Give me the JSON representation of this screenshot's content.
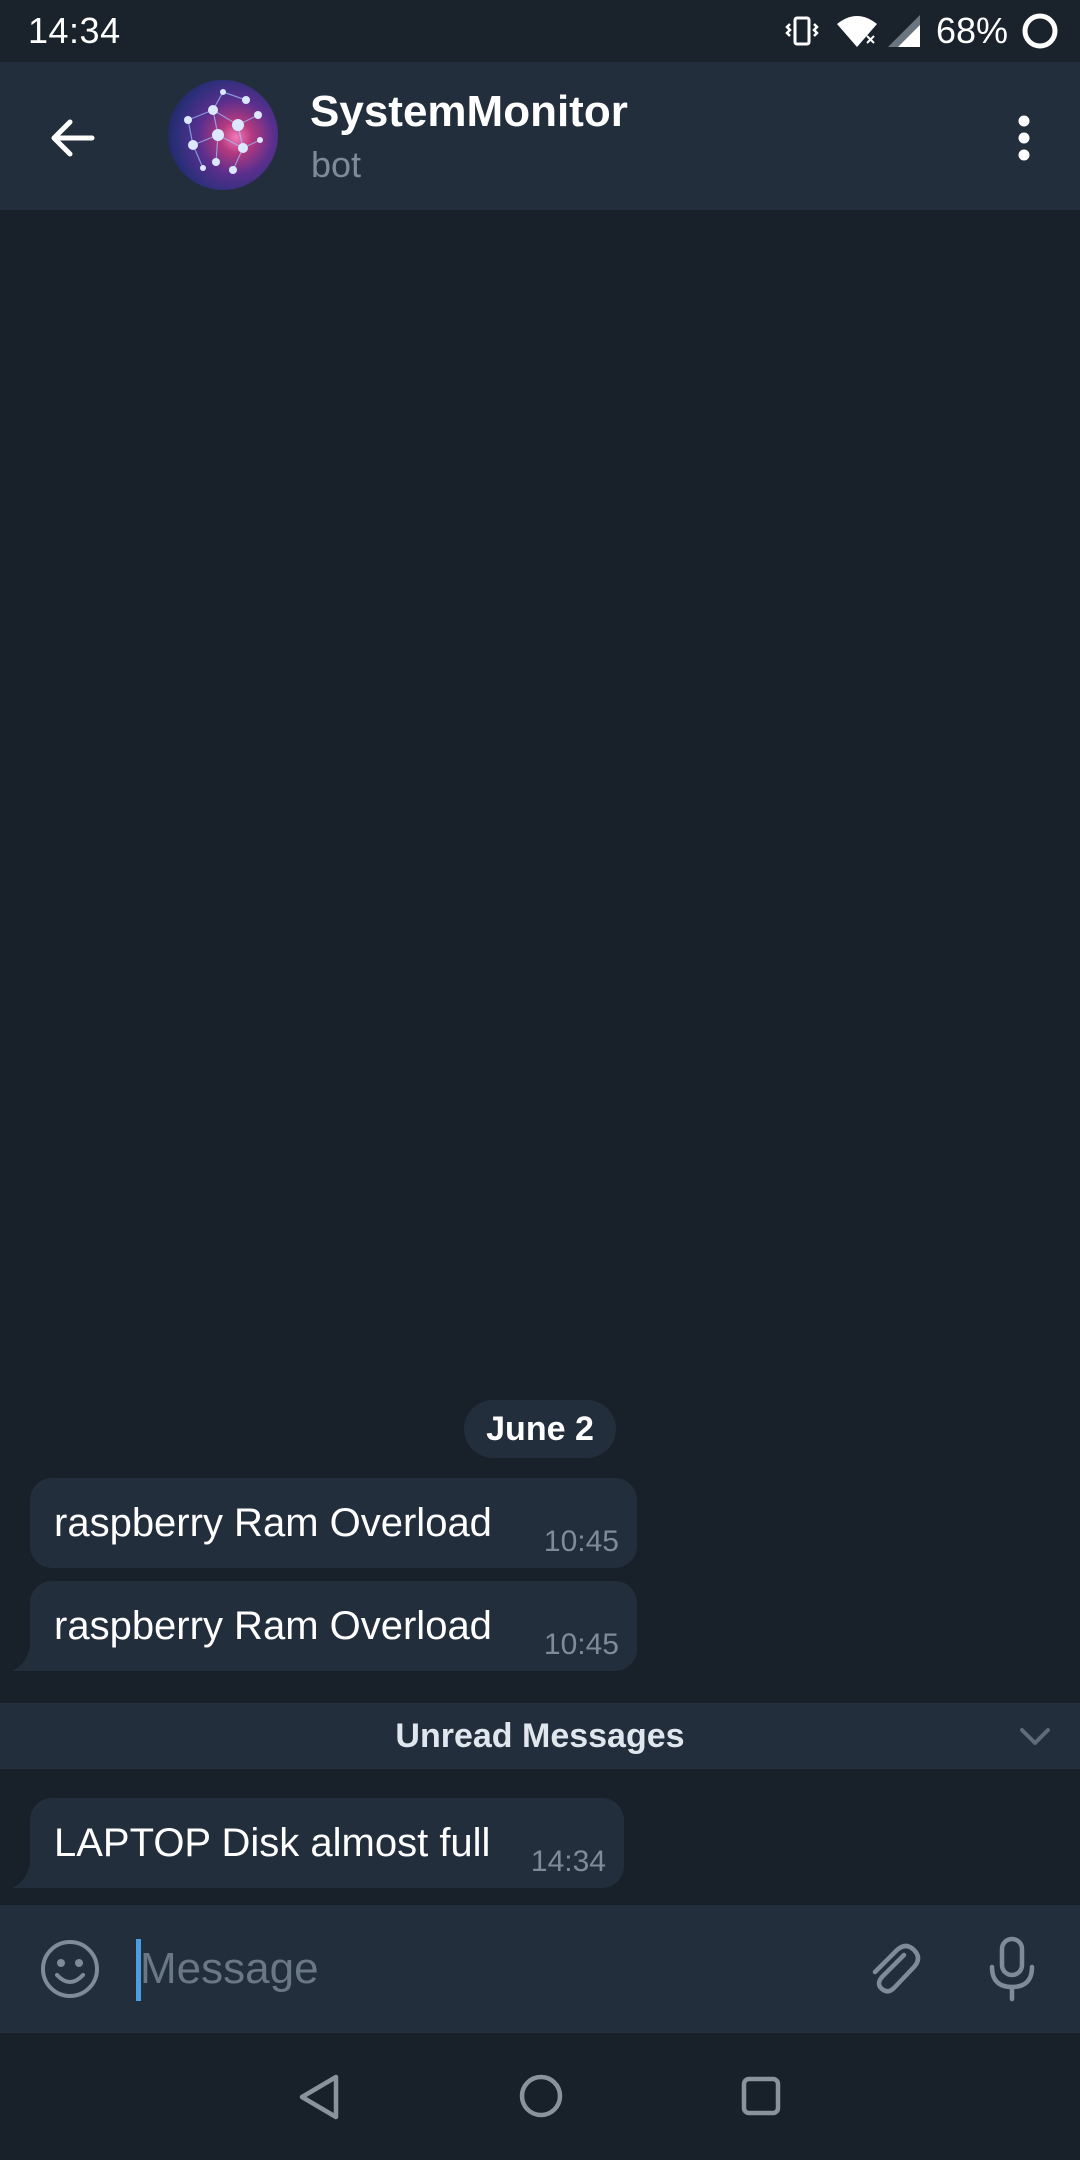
{
  "status_bar": {
    "time": "14:34",
    "battery": "68%"
  },
  "header": {
    "title": "SystemMonitor",
    "subtitle": "bot"
  },
  "chat": {
    "date_separator": "June 2",
    "messages": [
      {
        "text": "raspberry Ram Overload",
        "time": "10:45"
      },
      {
        "text": "raspberry Ram Overload",
        "time": "10:45"
      },
      {
        "text": "LAPTOP Disk almost full",
        "time": "14:34"
      }
    ],
    "unread_label": "Unread Messages"
  },
  "composer": {
    "placeholder": "Message",
    "value": ""
  },
  "colors": {
    "background": "#18202a",
    "header": "#232e3c",
    "bubble": "#232e3c",
    "accent": "#4a9de0",
    "muted": "#7f8b98"
  },
  "icons": {
    "back": "arrow-left-icon",
    "menu": "more-vertical-icon",
    "emoji": "smiley-icon",
    "attach": "paperclip-icon",
    "mic": "microphone-icon",
    "chevron": "chevron-down-icon"
  }
}
